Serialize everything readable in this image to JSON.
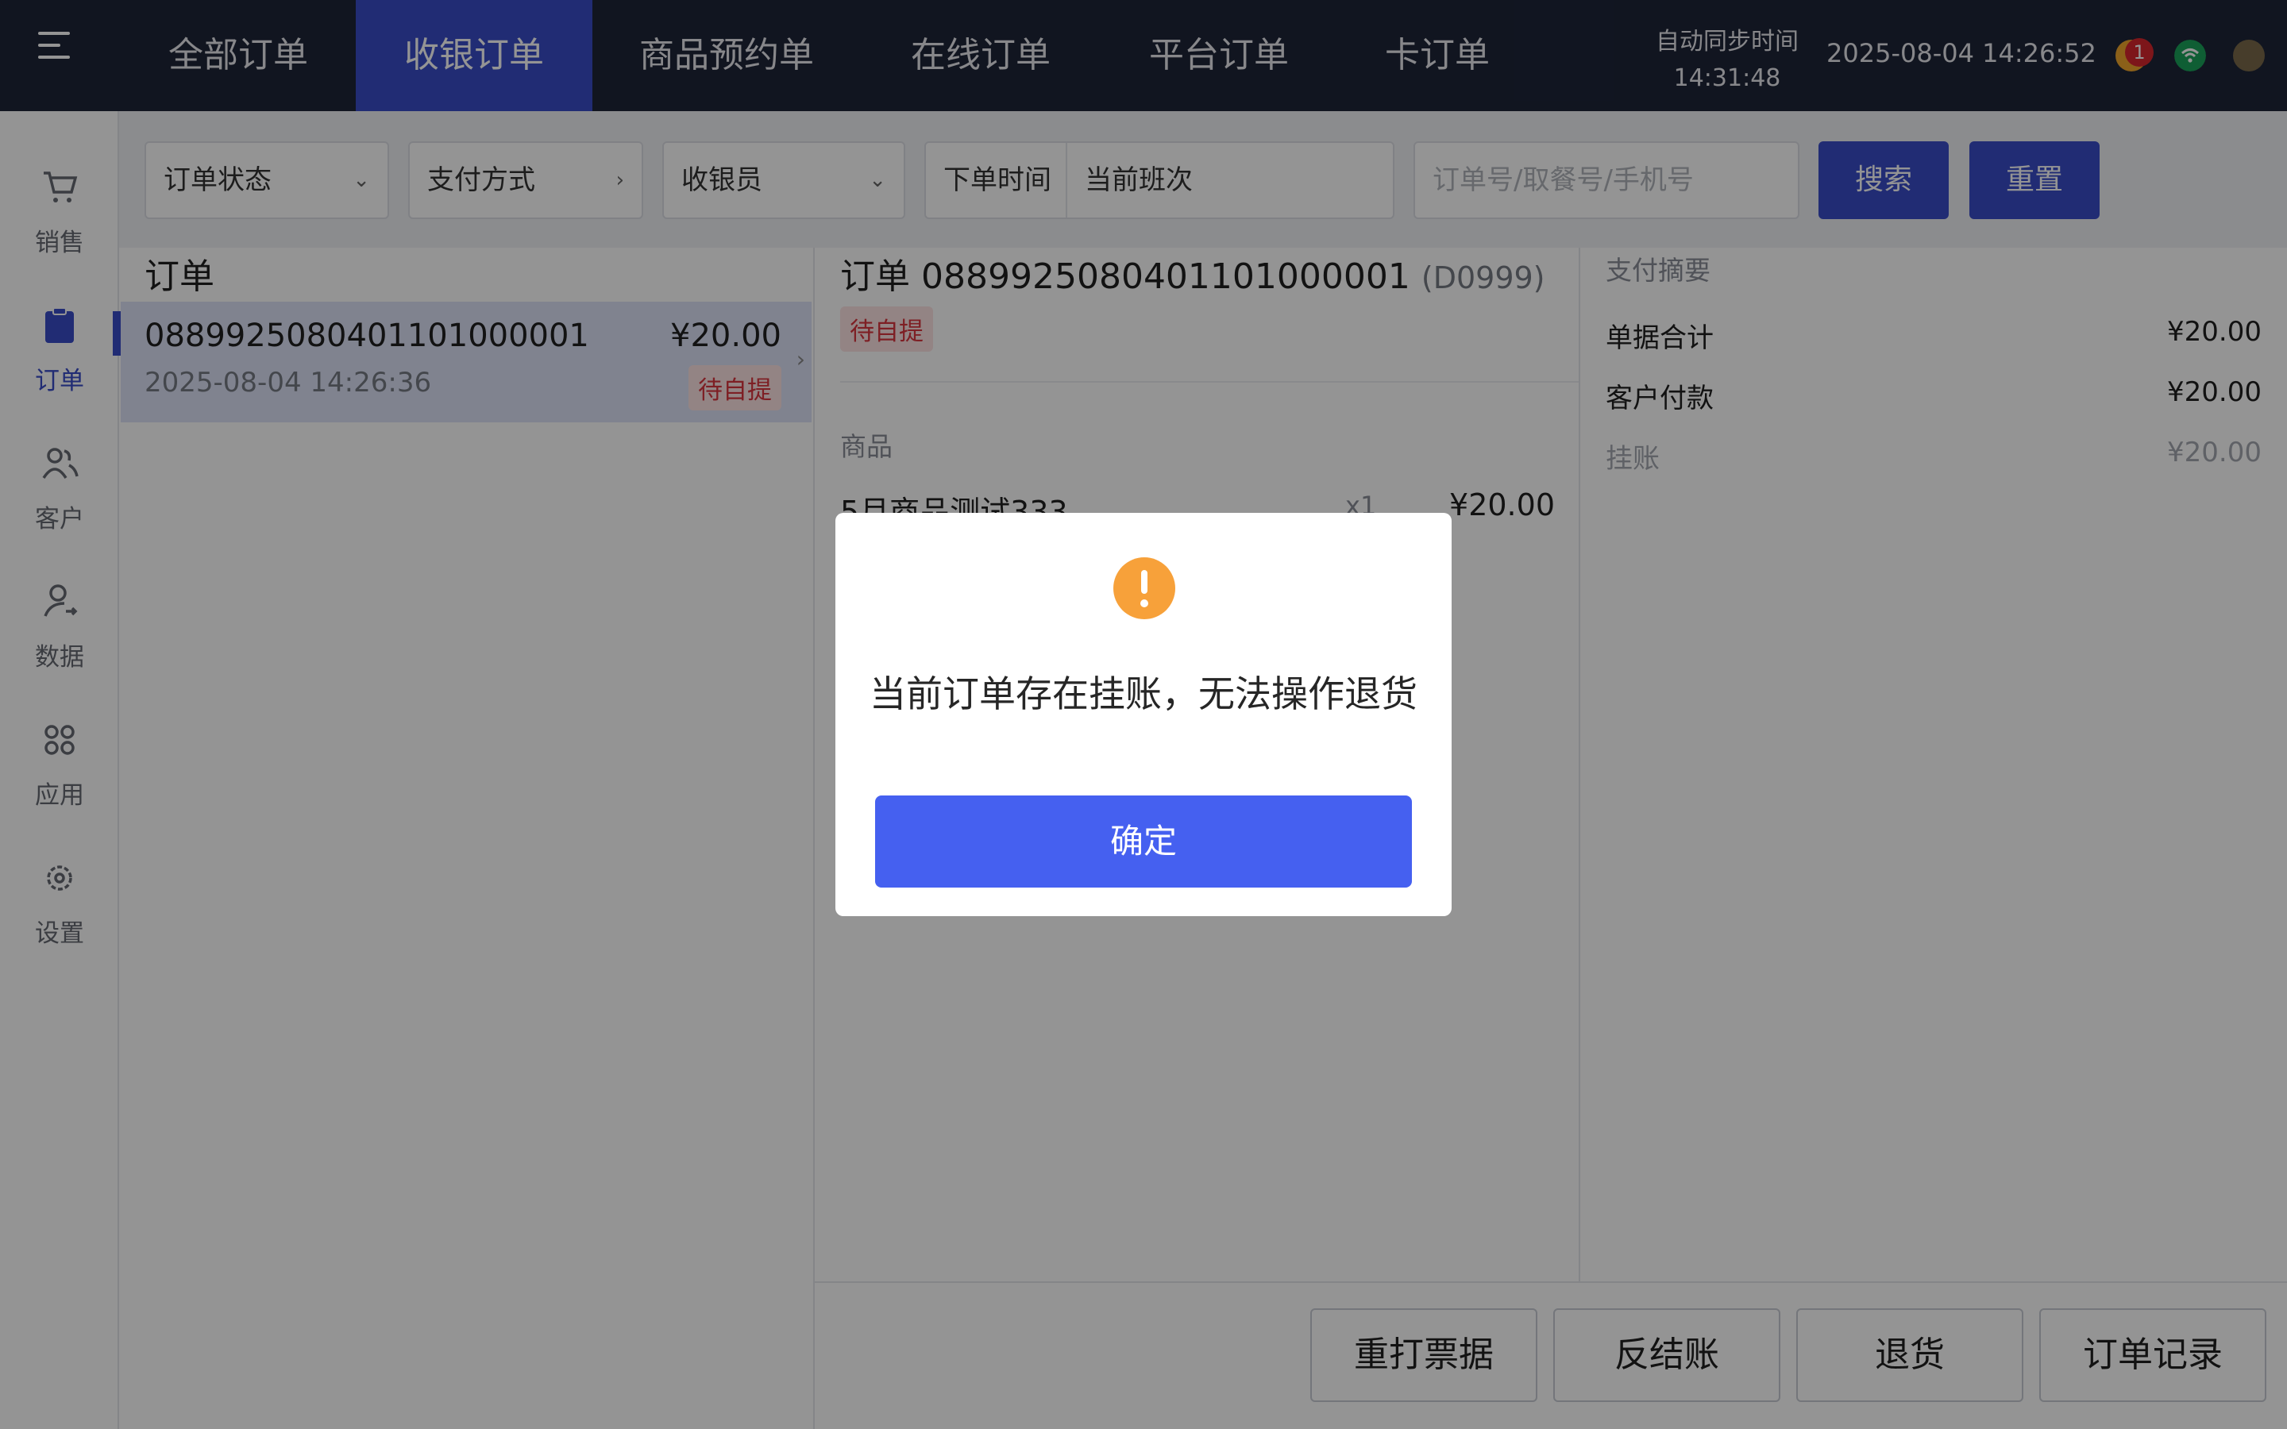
{
  "topbar": {
    "tabs": [
      {
        "label": "全部订单"
      },
      {
        "label": "收银订单"
      },
      {
        "label": "商品预约单"
      },
      {
        "label": "在线订单"
      },
      {
        "label": "平台订单"
      },
      {
        "label": "卡订单"
      }
    ],
    "active_tab": "收银订单",
    "sync_label": "自动同步时间",
    "sync_time": "14:31:48",
    "datetime": "2025-08-04 14:26:52",
    "notification_count": "1"
  },
  "sidebar": {
    "items": [
      {
        "label": "销售",
        "icon": "cart-icon"
      },
      {
        "label": "订单",
        "icon": "clipboard-icon"
      },
      {
        "label": "客户",
        "icon": "users-icon"
      },
      {
        "label": "数据",
        "icon": "user-data-icon"
      },
      {
        "label": "应用",
        "icon": "apps-icon"
      },
      {
        "label": "设置",
        "icon": "gear-icon"
      }
    ],
    "active": "订单"
  },
  "filters": {
    "order_status": "订单状态",
    "payment_method": "支付方式",
    "cashier": "收银员",
    "order_time_label": "下单时间",
    "order_time_value": "当前班次",
    "search_placeholder": "订单号/取餐号/手机号",
    "search_button": "搜索",
    "reset_button": "重置"
  },
  "order_list": {
    "title": "订单",
    "orders": [
      {
        "number": "0889925080401101000001",
        "amount": "¥20.00",
        "time": "2025-08-04 14:26:36",
        "status": "待自提"
      }
    ]
  },
  "detail": {
    "title_prefix": "订单",
    "number": "0889925080401101000001",
    "code": "(D0999)",
    "status": "待自提",
    "goods_label": "商品",
    "goods": [
      {
        "name": "5月商品测试333",
        "qty": "x1",
        "price": "¥20.00"
      }
    ]
  },
  "summary": {
    "title": "支付摘要",
    "rows": [
      {
        "label": "单据合计",
        "value": "¥20.00"
      },
      {
        "label": "客户付款",
        "value": "¥20.00"
      },
      {
        "label": "挂账",
        "value": "¥20.00"
      }
    ]
  },
  "actions": {
    "reprint": "重打票据",
    "reverse_checkout": "反结账",
    "refund": "退货",
    "order_log": "订单记录"
  },
  "dialog": {
    "icon": "warning-icon",
    "message": "当前订单存在挂账，无法操作退货",
    "confirm": "确定"
  },
  "colors": {
    "topbar_bg": "#1e2538",
    "accent": "#3a4cc9",
    "dialog_button": "#4560f0",
    "warning": "#f7a13a",
    "badge_text": "#d9363e"
  }
}
